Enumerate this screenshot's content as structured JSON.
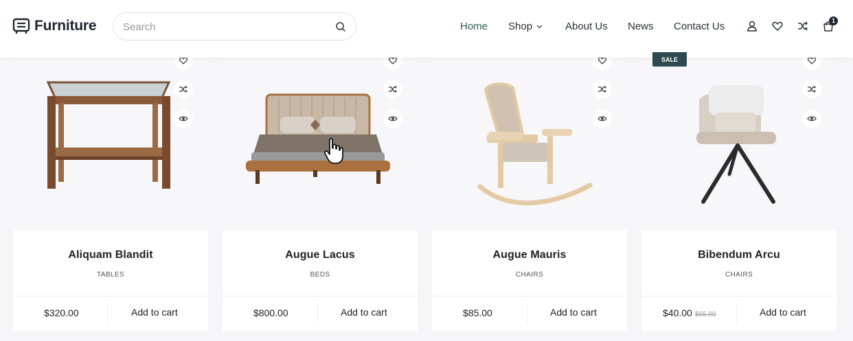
{
  "brand": {
    "name": "Furniture"
  },
  "search": {
    "placeholder": "Search"
  },
  "nav": {
    "items": [
      {
        "label": "Home",
        "active": true
      },
      {
        "label": "Shop",
        "has_dropdown": true
      },
      {
        "label": "About Us"
      },
      {
        "label": "News"
      },
      {
        "label": "Contact Us"
      }
    ]
  },
  "header_icons": [
    "user-icon",
    "heart-icon",
    "compare-icon",
    "cart-icon"
  ],
  "cart": {
    "count": "1"
  },
  "card_actions": [
    "wishlist-icon",
    "compare-icon",
    "quick-view-icon"
  ],
  "products": [
    {
      "name": "Aliquam Blandit",
      "category": "TABLES",
      "price": "$320.00",
      "old_price": "",
      "sale": false,
      "add_label": "Add to cart",
      "image": "wooden side table with glass top"
    },
    {
      "name": "Augue Lacus",
      "category": "BEDS",
      "price": "$800.00",
      "old_price": "",
      "sale": false,
      "add_label": "Add to cart",
      "image": "upholstered double bed"
    },
    {
      "name": "Augue Mauris",
      "category": "CHAIRS",
      "price": "$85.00",
      "old_price": "",
      "sale": false,
      "add_label": "Add to cart",
      "image": "wooden rocking chair"
    },
    {
      "name": "Bibendum Arcu",
      "category": "CHAIRS",
      "price": "$40.00",
      "old_price": "$65.00",
      "sale": true,
      "sale_label": "SALE",
      "add_label": "Add to cart",
      "image": "beige armchair with black legs"
    }
  ],
  "colors": {
    "accent": "#2e5c55",
    "sale_badge": "#2d4a50",
    "dark": "#1f2430"
  }
}
